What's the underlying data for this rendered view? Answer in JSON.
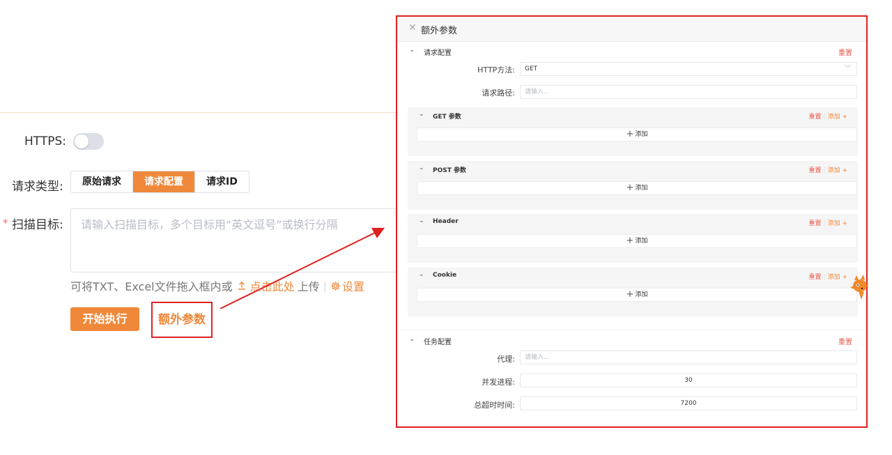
{
  "form": {
    "https_label": "HTTPS:",
    "https_enabled": false,
    "request_type_label": "请求类型:",
    "request_types": [
      "原始请求",
      "请求配置",
      "请求ID"
    ],
    "request_type_selected": "请求配置",
    "target_label": "扫描目标:",
    "required_mark": "*",
    "target_placeholder": "请输入扫描目标，多个目标用“英文逗号”或换行分隔",
    "hint_prefix": "可将TXT、Excel文件拖入框内或",
    "hint_click": "点击此处",
    "hint_upload": "上传",
    "hint_settings": "设置",
    "start_button": "开始执行",
    "extra_params_button": "额外参数"
  },
  "drawer": {
    "title": "额外参数",
    "request_config": {
      "title": "请求配置",
      "reset": "重置",
      "http_method_label": "HTTP方法:",
      "http_method_value": "GET",
      "path_label": "请求路径:",
      "path_placeholder": "请输入..."
    },
    "param_groups": [
      {
        "title": "GET 参数",
        "reset": "重置",
        "add": "添加 +",
        "add_row": "添加"
      },
      {
        "title": "POST 参数",
        "reset": "重置",
        "add": "添加 +",
        "add_row": "添加"
      },
      {
        "title": "Header",
        "reset": "重置",
        "add": "添加 +",
        "add_row": "添加"
      },
      {
        "title": "Cookie",
        "reset": "重置",
        "add": "添加 +",
        "add_row": "添加"
      }
    ],
    "task_config": {
      "title": "任务配置",
      "reset": "重置",
      "proxy_label": "代理:",
      "proxy_placeholder": "请输入...",
      "concurrency_label": "并发进程:",
      "concurrency_value": "30",
      "timeout_label": "总超时时间:",
      "timeout_value": "7200"
    }
  },
  "colors": {
    "accent": "#f0883a",
    "highlight_border": "#e02020",
    "reset": "#e8594d"
  }
}
